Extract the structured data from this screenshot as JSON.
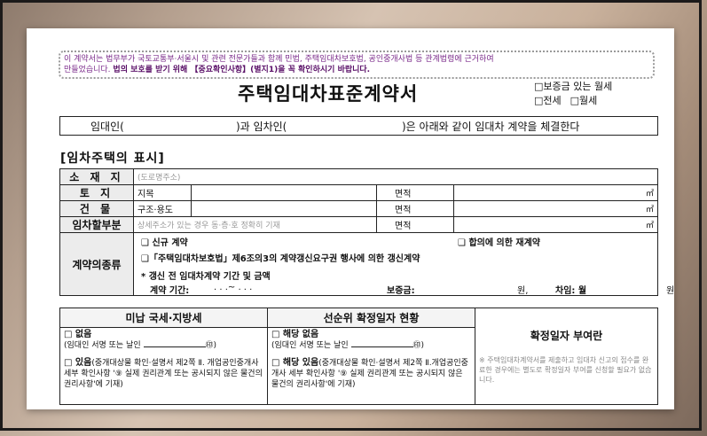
{
  "notice": {
    "line1": "이 계약서는 법무부가 국토교통부·서울시 및 관련 전문가들과 함께 민법, 주택임대차보호법, 공인중개사법 등 관계법령에 근거하여",
    "line2a": "만들었습니다.",
    "line2b": "법의 보호를 받기 위해 【중요확인사항】(별지1)을 꼭 확인하시기 바랍니다."
  },
  "title": "주택임대차표준계약서",
  "contract_types": [
    "□보증금 있는 월세",
    "□전세",
    "□월세"
  ],
  "parties": {
    "landlord": "임대인(",
    "between": ")과 임차인(",
    "tail": ")은 아래와 같이 임대차 계약을 체결한다"
  },
  "section_title": "[임차주택의 표시]",
  "rows": {
    "address": {
      "label": "소 재 지",
      "placeholder": "(도로명주소)"
    },
    "land": {
      "label": "토 지",
      "sub": "지목",
      "area": "면적",
      "unit": "㎡"
    },
    "building": {
      "label": "건 물",
      "sub": "구조·용도",
      "area": "면적",
      "unit": "㎡"
    },
    "lease_part": {
      "label": "임차할부분",
      "hint": "상세주소가 있는 경우 동·층·호 정확히 기재",
      "area": "면적",
      "unit": "㎡"
    }
  },
  "contract_kind": {
    "label": "계약의종류",
    "new": "❑ 신규 계약",
    "renew_agree": "❑ 합의에 의한 재계약",
    "renew_right": "❑「주택임대차보호법」제6조의3의 계약갱신요구권 행사에 의한 갱신계약",
    "prev_title": "* 갱신 전 임대차계약 기간 및 금액",
    "period": "계약 기간:",
    "period_dots": ".   .   .~   .   .   .",
    "deposit": "보증금:",
    "won1": "원,",
    "rent": "차임: 월",
    "won2": "원"
  },
  "bottom": {
    "tax_head": "미납 국세·지방세",
    "priority_head": "선순위 확정일자 현황",
    "tax_none": "□ 없음",
    "tax_none_sign": "(임대인 서명 또는 날인",
    "sign_mark": "㊞)",
    "tax_exist": "□ 있음",
    "tax_exist_desc": "(중개대상물 확인·설명서 제2쪽 Ⅱ. 개업공인중개사 세부 확인사항 '⑨ 실제 권리관계 또는 공시되지 않은 물건의 권리사항'에 기재)",
    "pri_none": "□ 해당 없음",
    "pri_none_sign": "(임대인 서명 또는 날인",
    "pri_exist": "□ 해당 있음",
    "pri_exist_desc": "(중개대상물 확인·설명서 제2쪽 Ⅱ.개업공인중개사 세부 확인사항 '⑨ 실제 권리관계 또는 공시되지 않은 물건의 권리사항'에 기재)",
    "confirm_head": "확정일자 부여란",
    "confirm_note": "※ 주택임대차계약서를 제출하고 임대차 신고의 접수를 완료한 경우에는 별도로 확정일자 부여를 신청할 필요가 없습니다."
  }
}
